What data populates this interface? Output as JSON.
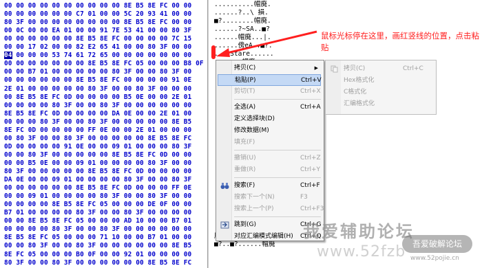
{
  "hex_rows": [
    "00 00 00 00 00 00 00 00 00 00 8E B5 8E FC 00 00",
    "00 00 00 00 00 00 C7 01 00 00 5C 20 93 41 00 00",
    "80 3F 00 00 00 00 00 00 00 00 8E B5 8E FC 00 00",
    "00 0C 00 00 EA 01 00 00 91 7E 53 41 00 00 80 3F",
    "00 00 00 00 00 00 8E B5 8E FC 00 00 00 00 7C 15",
    "00 00 17 02 00 00 82 E2 65 41 00 00 80 3F 00 00",
    "04 00 00 00 53 74 61 72 65 00 00 00 00 00 00 00",
    "00 00 00 00 00 00 00 8E B5 8E FC 05 00 00 00 B8 0F",
    "00 00 B7 01 00 00 00 00 00 80 3F 00 00 80 3F 00",
    "00 00 00 00 00 00 8E B5 8E FC 00 00 00 00 91 0E",
    "2E 01 00 00 00 00 00 80 3F 00 00 80 3F 00 00 00",
    "00 8E B5 8E FC 0D 00 00 00 00 B5 0E 00 00 2E 01",
    "00 00 00 00 80 3F 00 00 80 3F 00 00 00 00 00 00",
    "8E B5 8E FC 0D 00 00 00 00 DA 0E 00 00 2E 01 00",
    "00 00 00 80 3F 00 00 80 3F 00 00 00 00 00 8E B5",
    "8E FC 0D 00 00 00 00 FF 0E 00 00 2E 01 00 00 00",
    "00 80 3F 00 00 80 3F 00 00 00 00 00 8E B5 8E FC",
    "0D 00 00 00 00 91 0E 00 00 09 01 00 00 00 80 3F",
    "00 00 80 3F 00 00 00 00 00 8E B5 8E FC 0D 00 00",
    "00 00 B5 0E 00 00 09 01 00 00 00 00 80 3F 00 00",
    "80 3F 00 00 00 00 00 8E B5 8E FC 0D 00 00 00 00",
    "DA 0E 00 00 09 01 00 00 00 00 80 3F 00 00 80 3F",
    "00 00 00 00 00 00 8E B5 8E FC 0D 00 00 00 FF 0E",
    "00 00 09 01 00 00 00 00 80 3F 00 00 80 3F 00 00",
    "00 00 00 00 8E B5 8E FC 05 00 00 00 DE 0F 00 00",
    "B7 01 00 00 00 00 80 3F 00 00 80 3F 00 00 00 00",
    "00 00 8E B5 8E FC 05 00 00 00 AD 10 00 00 B7 01",
    "00 00 00 00 80 3F 00 00 80 3F 00 00 00 00 00 00",
    "8E B5 8E FC 05 00 00 00 71 10 00 00 B7 01 00 00",
    "00 00 80 3F 00 00 80 3F 00 00 00 00 00 00 8E B5",
    "8E FC 05 00 00 00 B0 0F 00 00 92 01 00 00 00 00",
    "80 3F 00 00 80 3F 00 00 00 00 00 00 8E B5 8E FC"
  ],
  "selected_byte": "04",
  "ascii_rows": [
    "..........帽廃.",
    "......?..\\ 損.",
    "■?........帽廃.",
    "......?~SA..■?",
    "......帽廃...|.",
    "......傍eA..■?.",
    "....Stare......",
    ".......帽廃....",
    "",
    "",
    "",
    "",
    "",
    "",
    "",
    "",
    "",
    "",
    "",
    "",
    "",
    "",
    "",
    "",
    "",
    "",
    "",
    "..■?..■?.....帽",
    "廃........?....",
    "■?..■?......帽廃"
  ],
  "annotation": "鼠标光标停在这里，画红竖线的位置，点击粘贴",
  "context_menu": {
    "items": [
      {
        "label": "拷贝(C)",
        "shortcut": "",
        "submenu": true,
        "disabled": false,
        "icon": ""
      },
      {
        "label": "粘贴(P)",
        "shortcut": "Ctrl+V",
        "submenu": false,
        "disabled": false,
        "icon": "",
        "highlighted": true
      },
      {
        "label": "剪切(T)",
        "shortcut": "Ctrl+X",
        "submenu": false,
        "disabled": true,
        "icon": ""
      },
      {
        "sep": true
      },
      {
        "label": "全选(A)",
        "shortcut": "Ctrl+A",
        "submenu": false,
        "disabled": false,
        "icon": ""
      },
      {
        "label": "定义选择块(D)",
        "shortcut": "",
        "submenu": false,
        "disabled": false,
        "icon": ""
      },
      {
        "label": "修改数据(M)",
        "shortcut": "",
        "submenu": false,
        "disabled": false,
        "icon": ""
      },
      {
        "label": "填充(F)",
        "shortcut": "",
        "submenu": false,
        "disabled": true,
        "icon": ""
      },
      {
        "sep": true
      },
      {
        "label": "撤销(U)",
        "shortcut": "Ctrl+Z",
        "submenu": false,
        "disabled": true,
        "icon": ""
      },
      {
        "label": "重做(R)",
        "shortcut": "Ctrl+Y",
        "submenu": false,
        "disabled": true,
        "icon": ""
      },
      {
        "sep": true
      },
      {
        "label": "搜索(F)",
        "shortcut": "Ctrl+F",
        "submenu": false,
        "disabled": false,
        "icon": "binoculars-icon"
      },
      {
        "label": "搜索下一个(N)",
        "shortcut": "F3",
        "submenu": false,
        "disabled": true,
        "icon": ""
      },
      {
        "label": "搜索上一个(P)",
        "shortcut": "Ctrl+F3",
        "submenu": false,
        "disabled": true,
        "icon": ""
      },
      {
        "sep": true
      },
      {
        "label": "跳到(G)",
        "shortcut": "Ctrl+G",
        "submenu": false,
        "disabled": false,
        "icon": "goto-icon"
      },
      {
        "label": "对应汇编模式编辑(H)",
        "shortcut": "Ctrl+Q",
        "submenu": false,
        "disabled": false,
        "icon": ""
      }
    ]
  },
  "submenu": {
    "items": [
      {
        "label": "拷贝(C)",
        "shortcut": "Ctrl+C"
      },
      {
        "label": "Hex格式化",
        "shortcut": ""
      },
      {
        "label": "C格式化",
        "shortcut": ""
      },
      {
        "label": "汇编格式化",
        "shortcut": ""
      }
    ]
  },
  "watermark": {
    "title": "我爱辅助论坛",
    "domain": "www.52fzb",
    "badge": "吾爱破解论坛",
    "url": "www.52pojie.cn"
  }
}
